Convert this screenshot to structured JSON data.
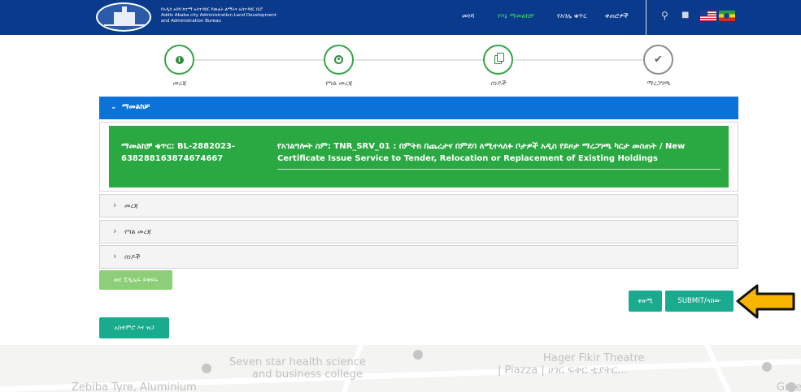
{
  "header": {
    "logo_lines": [
      "የአዲስ አበባ ከተማ አስተዳደር የመሬት ልማትና አስተዳደር ቢሮ",
      "Addis Ababa city Administration Land Development",
      "and Administration Bureau"
    ],
    "nav": [
      "መነሻ",
      "የእኔ ማመልከቻ",
      "የአገሌ ቁጥር",
      "ቀጠሮዎች"
    ],
    "active_nav_index": 1,
    "icons": [
      "search-icon",
      "lock-icon",
      "us-flag-icon",
      "ethiopia-flag-icon"
    ]
  },
  "stepper": {
    "steps": [
      {
        "label": "መረጃ",
        "icon": "info-icon",
        "done": true
      },
      {
        "label": "የግል መረጃ",
        "icon": "user-icon",
        "done": true
      },
      {
        "label": "ሰነዶች",
        "icon": "documents-icon",
        "done": true
      },
      {
        "label": "ማረጋገጫ",
        "icon": "check-icon",
        "done": false
      }
    ]
  },
  "accordion": {
    "open_title": "ማመልከቻ",
    "application_no": "ማመልከቻ ቁጥር: BL-2882023-638288163874674667",
    "service_name": "የአገልግሎት ስም: TNR_SRV_01 : በምትክ በጨረታና በምደባ ለሚተላለፉ ቦታዎች አዲስ የይዞታ ማረጋገጫ ካርታ መስጠት / New Certificate Issue Service to Tender, Relocation or Replacement of Existing Holdings",
    "collapsed_sections": [
      "መረጃ",
      "የግል መረጃ",
      "ሰነዶች"
    ]
  },
  "buttons": {
    "back": "ወደ ፒዲኤፍ ይቀይሩ",
    "save": "ቀጽሚ",
    "submit": "SUBMIT/ላከው",
    "terms": "አስተምሮ እና ዝጋ"
  },
  "map": {
    "labels": [
      "Seven star health science",
      "and business college",
      "Hager Fikir Theatre",
      "| Piazza | ሀገር ፍቅር ቲያትር...",
      "Zebiba Tyre, Aluminium",
      "Gree"
    ]
  },
  "colors": {
    "header_bg": "#0a3a8c",
    "accordion_head": "#0b72d8",
    "success": "#2aa841",
    "teal": "#1aab8e",
    "arrow": "#f7b500"
  }
}
